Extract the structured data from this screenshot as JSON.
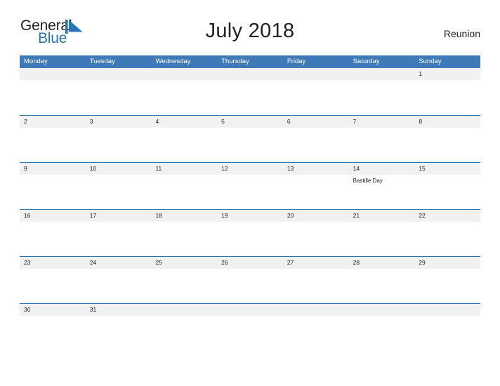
{
  "logo": {
    "word_dark": "General",
    "word_blue": "Blue",
    "triangle_color": "#2a74b8",
    "dark_color": "#231f20",
    "blue_color": "#2a74b8"
  },
  "header": {
    "title": "July 2018",
    "region": "Reunion"
  },
  "colors": {
    "header_blue": "#3e7ab8",
    "rule_blue": "#2e75b6",
    "band_gray": "#f1f1f1",
    "text": "#222222",
    "page_background": "#ffffff"
  },
  "weekdays": [
    "Monday",
    "Tuesday",
    "Wednesday",
    "Thursday",
    "Friday",
    "Saturday",
    "Sunday"
  ],
  "weeks": [
    {
      "days": [
        {
          "number": "",
          "events": []
        },
        {
          "number": "",
          "events": []
        },
        {
          "number": "",
          "events": []
        },
        {
          "number": "",
          "events": []
        },
        {
          "number": "",
          "events": []
        },
        {
          "number": "",
          "events": []
        },
        {
          "number": "1",
          "events": []
        }
      ]
    },
    {
      "days": [
        {
          "number": "2",
          "events": []
        },
        {
          "number": "3",
          "events": []
        },
        {
          "number": "4",
          "events": []
        },
        {
          "number": "5",
          "events": []
        },
        {
          "number": "6",
          "events": []
        },
        {
          "number": "7",
          "events": []
        },
        {
          "number": "8",
          "events": []
        }
      ]
    },
    {
      "days": [
        {
          "number": "9",
          "events": []
        },
        {
          "number": "10",
          "events": []
        },
        {
          "number": "11",
          "events": []
        },
        {
          "number": "12",
          "events": []
        },
        {
          "number": "13",
          "events": []
        },
        {
          "number": "14",
          "events": [
            "Bastille Day"
          ]
        },
        {
          "number": "15",
          "events": []
        }
      ]
    },
    {
      "days": [
        {
          "number": "16",
          "events": []
        },
        {
          "number": "17",
          "events": []
        },
        {
          "number": "18",
          "events": []
        },
        {
          "number": "19",
          "events": []
        },
        {
          "number": "20",
          "events": []
        },
        {
          "number": "21",
          "events": []
        },
        {
          "number": "22",
          "events": []
        }
      ]
    },
    {
      "days": [
        {
          "number": "23",
          "events": []
        },
        {
          "number": "24",
          "events": []
        },
        {
          "number": "25",
          "events": []
        },
        {
          "number": "26",
          "events": []
        },
        {
          "number": "27",
          "events": []
        },
        {
          "number": "28",
          "events": []
        },
        {
          "number": "29",
          "events": []
        }
      ]
    },
    {
      "days": [
        {
          "number": "30",
          "events": []
        },
        {
          "number": "31",
          "events": []
        },
        {
          "number": "",
          "events": []
        },
        {
          "number": "",
          "events": []
        },
        {
          "number": "",
          "events": []
        },
        {
          "number": "",
          "events": []
        },
        {
          "number": "",
          "events": []
        }
      ]
    }
  ]
}
